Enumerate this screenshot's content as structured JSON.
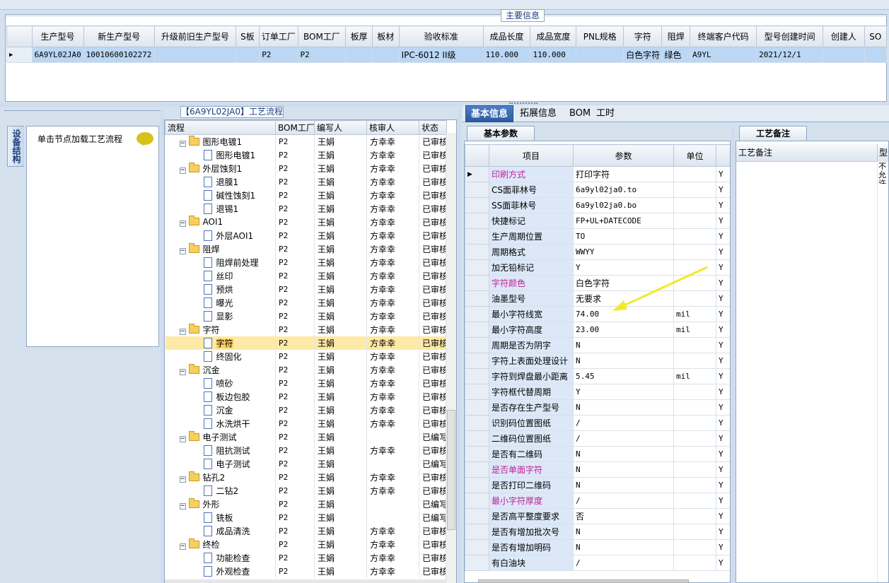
{
  "main": {
    "title": "主要信息",
    "columns": [
      "生产型号",
      "新生产型号",
      "升级前旧生产型号",
      "S板",
      "订单工厂",
      "BOM工厂",
      "板厚",
      "板材",
      "验收标准",
      "成品长度",
      "成品宽度",
      "PNL规格",
      "字符",
      "阻焊",
      "终端客户代码",
      "型号创建时间",
      "创建人",
      "SO"
    ],
    "row": [
      "6A9YL02JA0",
      "10010600102272",
      "",
      "",
      "P2",
      "P2",
      "",
      "",
      "IPC-6012 II级",
      "110.000",
      "110.000",
      "",
      "白色字符",
      "绿色",
      "A9YL",
      "2021/12/1",
      "",
      ""
    ]
  },
  "left": {
    "vtab": "设备结构",
    "hint": "单击节点加载工艺流程"
  },
  "process": {
    "title": "【6A9YL02JA0】工艺流程",
    "headers": [
      "流程",
      "BOM工厂",
      "编写人",
      "核审人",
      "状态"
    ],
    "rows": [
      {
        "lvl": 0,
        "name": "图形电镀1",
        "bom": "P2",
        "writer": "王娟",
        "reviewer": "方幸幸",
        "status": "已审核"
      },
      {
        "lvl": 1,
        "name": "图形电镀1",
        "bom": "P2",
        "writer": "王娟",
        "reviewer": "方幸幸",
        "status": "已审核"
      },
      {
        "lvl": 0,
        "name": "外层蚀刻1",
        "bom": "P2",
        "writer": "王娟",
        "reviewer": "方幸幸",
        "status": "已审核"
      },
      {
        "lvl": 1,
        "name": "退膜1",
        "bom": "P2",
        "writer": "王娟",
        "reviewer": "方幸幸",
        "status": "已审核"
      },
      {
        "lvl": 1,
        "name": "碱性蚀刻1",
        "bom": "P2",
        "writer": "王娟",
        "reviewer": "方幸幸",
        "status": "已审核"
      },
      {
        "lvl": 1,
        "name": "退锡1",
        "bom": "P2",
        "writer": "王娟",
        "reviewer": "方幸幸",
        "status": "已审核"
      },
      {
        "lvl": 0,
        "name": "AOI1",
        "bom": "P2",
        "writer": "王娟",
        "reviewer": "方幸幸",
        "status": "已审核"
      },
      {
        "lvl": 1,
        "name": "外层AOI1",
        "bom": "P2",
        "writer": "王娟",
        "reviewer": "方幸幸",
        "status": "已审核"
      },
      {
        "lvl": 0,
        "name": "阻焊",
        "bom": "P2",
        "writer": "王娟",
        "reviewer": "方幸幸",
        "status": "已审核"
      },
      {
        "lvl": 1,
        "name": "阻焊前处理",
        "bom": "P2",
        "writer": "王娟",
        "reviewer": "方幸幸",
        "status": "已审核"
      },
      {
        "lvl": 1,
        "name": "丝印",
        "bom": "P2",
        "writer": "王娟",
        "reviewer": "方幸幸",
        "status": "已审核"
      },
      {
        "lvl": 1,
        "name": "预烘",
        "bom": "P2",
        "writer": "王娟",
        "reviewer": "方幸幸",
        "status": "已审核"
      },
      {
        "lvl": 1,
        "name": "曝光",
        "bom": "P2",
        "writer": "王娟",
        "reviewer": "方幸幸",
        "status": "已审核"
      },
      {
        "lvl": 1,
        "name": "显影",
        "bom": "P2",
        "writer": "王娟",
        "reviewer": "方幸幸",
        "status": "已审核"
      },
      {
        "lvl": 0,
        "name": "字符",
        "bom": "P2",
        "writer": "王娟",
        "reviewer": "方幸幸",
        "status": "已审核"
      },
      {
        "lvl": 1,
        "name": "字符",
        "bom": "P2",
        "writer": "王娟",
        "reviewer": "方幸幸",
        "status": "已审核",
        "selected": true
      },
      {
        "lvl": 1,
        "name": "终固化",
        "bom": "P2",
        "writer": "王娟",
        "reviewer": "方幸幸",
        "status": "已审核"
      },
      {
        "lvl": 0,
        "name": "沉金",
        "bom": "P2",
        "writer": "王娟",
        "reviewer": "方幸幸",
        "status": "已审核"
      },
      {
        "lvl": 1,
        "name": "喷砂",
        "bom": "P2",
        "writer": "王娟",
        "reviewer": "方幸幸",
        "status": "已审核"
      },
      {
        "lvl": 1,
        "name": "板边包胶",
        "bom": "P2",
        "writer": "王娟",
        "reviewer": "方幸幸",
        "status": "已审核"
      },
      {
        "lvl": 1,
        "name": "沉金",
        "bom": "P2",
        "writer": "王娟",
        "reviewer": "方幸幸",
        "status": "已审核"
      },
      {
        "lvl": 1,
        "name": "水洗烘干",
        "bom": "P2",
        "writer": "王娟",
        "reviewer": "方幸幸",
        "status": "已审核"
      },
      {
        "lvl": 0,
        "name": "电子测试",
        "bom": "P2",
        "writer": "王娟",
        "reviewer": "",
        "status": "已编写"
      },
      {
        "lvl": 1,
        "name": "阻抗测试",
        "bom": "P2",
        "writer": "王娟",
        "reviewer": "方幸幸",
        "status": "已审核"
      },
      {
        "lvl": 1,
        "name": "电子测试",
        "bom": "P2",
        "writer": "王娟",
        "reviewer": "",
        "status": "已编写"
      },
      {
        "lvl": 0,
        "name": "钻孔2",
        "bom": "P2",
        "writer": "王娟",
        "reviewer": "方幸幸",
        "status": "已审核"
      },
      {
        "lvl": 1,
        "name": "二钻2",
        "bom": "P2",
        "writer": "王娟",
        "reviewer": "方幸幸",
        "status": "已审核"
      },
      {
        "lvl": 0,
        "name": "外形",
        "bom": "P2",
        "writer": "王娟",
        "reviewer": "",
        "status": "已编写"
      },
      {
        "lvl": 1,
        "name": "铣板",
        "bom": "P2",
        "writer": "王娟",
        "reviewer": "",
        "status": "已编写"
      },
      {
        "lvl": 1,
        "name": "成品清洗",
        "bom": "P2",
        "writer": "王娟",
        "reviewer": "方幸幸",
        "status": "已审核"
      },
      {
        "lvl": 0,
        "name": "终检",
        "bom": "P2",
        "writer": "王娟",
        "reviewer": "方幸幸",
        "status": "已审核"
      },
      {
        "lvl": 1,
        "name": "功能检查",
        "bom": "P2",
        "writer": "王娟",
        "reviewer": "方幸幸",
        "status": "已审核"
      },
      {
        "lvl": 1,
        "name": "外观检查",
        "bom": "P2",
        "writer": "王娟",
        "reviewer": "方幸幸",
        "status": "已审核"
      }
    ]
  },
  "tabs": [
    "基本信息",
    "拓展信息",
    "BOM",
    "工时"
  ],
  "basic": {
    "tab_label": "基本参数",
    "headers": [
      "项目",
      "参数",
      "单位"
    ],
    "rows": [
      {
        "item": "印刷方式",
        "value": "打印字符",
        "unit": "",
        "flag": "Y",
        "pink": true,
        "current": true
      },
      {
        "item": "CS面菲林号",
        "value": "6a9yl02ja0.to",
        "unit": "",
        "flag": "Y",
        "mono": true
      },
      {
        "item": "SS面菲林号",
        "value": "6a9yl02ja0.bo",
        "unit": "",
        "flag": "Y",
        "mono": true
      },
      {
        "item": "快捷标记",
        "value": "FP+UL+DATECODE",
        "unit": "",
        "flag": "Y",
        "mono": true
      },
      {
        "item": "生产周期位置",
        "value": "TO",
        "unit": "",
        "flag": "Y",
        "mono": true
      },
      {
        "item": "周期格式",
        "value": "WWYY",
        "unit": "",
        "flag": "Y",
        "mono": true
      },
      {
        "item": "加无铅标记",
        "value": "Y",
        "unit": "",
        "flag": "Y",
        "mono": true
      },
      {
        "item": "字符颜色",
        "value": "白色字符",
        "unit": "",
        "flag": "Y",
        "pink": true
      },
      {
        "item": "油墨型号",
        "value": "无要求",
        "unit": "",
        "flag": "Y"
      },
      {
        "item": "最小字符线宽",
        "value": "74.00",
        "unit": "mil",
        "flag": "Y",
        "mono": true
      },
      {
        "item": "最小字符高度",
        "value": "23.00",
        "unit": "mil",
        "flag": "Y",
        "mono": true
      },
      {
        "item": "周期是否为阴字",
        "value": "N",
        "unit": "",
        "flag": "Y",
        "mono": true
      },
      {
        "item": "字符上表面处理设计",
        "value": "N",
        "unit": "",
        "flag": "Y",
        "mono": true
      },
      {
        "item": "字符到焊盘最小距离",
        "value": "5.45",
        "unit": "mil",
        "flag": "Y",
        "mono": true
      },
      {
        "item": "字符框代替周期",
        "value": "Y",
        "unit": "",
        "flag": "Y",
        "mono": true
      },
      {
        "item": "是否存在生产型号",
        "value": "N",
        "unit": "",
        "flag": "Y",
        "mono": true
      },
      {
        "item": "识别码位置图纸",
        "value": "/",
        "unit": "",
        "flag": "Y",
        "mono": true
      },
      {
        "item": "二维码位置图纸",
        "value": "/",
        "unit": "",
        "flag": "Y",
        "mono": true
      },
      {
        "item": "是否有二维码",
        "value": "N",
        "unit": "",
        "flag": "Y",
        "mono": true
      },
      {
        "item": "是否单面字符",
        "value": "N",
        "unit": "",
        "flag": "Y",
        "pink": true,
        "mono": true
      },
      {
        "item": "是否打印二维码",
        "value": "N",
        "unit": "",
        "flag": "Y",
        "mono": true
      },
      {
        "item": "最小字符厚度",
        "value": "/",
        "unit": "",
        "flag": "Y",
        "pink": true,
        "mono": true
      },
      {
        "item": "是否高平整度要求",
        "value": "否",
        "unit": "",
        "flag": "Y"
      },
      {
        "item": "是否有增加批次号",
        "value": "N",
        "unit": "",
        "flag": "Y",
        "mono": true
      },
      {
        "item": "是否有增加明码",
        "value": "N",
        "unit": "",
        "flag": "Y",
        "mono": true
      },
      {
        "item": "有白油块",
        "value": "/",
        "unit": "",
        "flag": "Y",
        "mono": true
      }
    ]
  },
  "remark": {
    "tab_label": "工艺备注",
    "header": "工艺备注",
    "header2": "型号",
    "cell": "不允许与FP"
  },
  "colors": {
    "accent": "#2c5aa0",
    "selected_row": "#bcd7f3",
    "highlight": "#fcd35a",
    "pink": "#c0209a",
    "arrow": "#f0ea2a"
  }
}
